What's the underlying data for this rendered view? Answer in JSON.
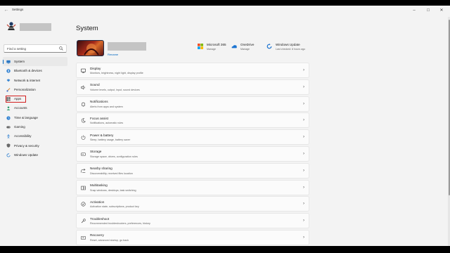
{
  "window": {
    "title": "Settings",
    "back_glyph": "←",
    "min_glyph": "–",
    "max_glyph": "☐",
    "close_glyph": "✕"
  },
  "search": {
    "placeholder": "Find a setting"
  },
  "sidebar": {
    "items": [
      {
        "label": "System",
        "icon": "system-icon",
        "active": true
      },
      {
        "label": "Bluetooth & devices",
        "icon": "bluetooth-icon"
      },
      {
        "label": "Network & internet",
        "icon": "network-icon"
      },
      {
        "label": "Personalization",
        "icon": "personalization-icon"
      },
      {
        "label": "Apps",
        "icon": "apps-icon",
        "highlighted": true
      },
      {
        "label": "Accounts",
        "icon": "accounts-icon"
      },
      {
        "label": "Time & language",
        "icon": "time-language-icon"
      },
      {
        "label": "Gaming",
        "icon": "gaming-icon"
      },
      {
        "label": "Accessibility",
        "icon": "accessibility-icon"
      },
      {
        "label": "Privacy & security",
        "icon": "privacy-icon"
      },
      {
        "label": "Windows Update",
        "icon": "windows-update-icon"
      }
    ]
  },
  "main": {
    "title": "System",
    "rename_label": "Rename",
    "quick_links": [
      {
        "title": "Microsoft 365",
        "subtitle": "Manage",
        "icon": "microsoft-365-icon"
      },
      {
        "title": "OneDrive",
        "subtitle": "Manage",
        "icon": "onedrive-icon"
      },
      {
        "title": "Windows Update",
        "subtitle": "Last checked: 8 hours ago",
        "icon": "windows-update-icon"
      }
    ],
    "cards": [
      {
        "title": "Display",
        "subtitle": "Monitors, brightness, night light, display profile",
        "icon": "display-icon"
      },
      {
        "title": "Sound",
        "subtitle": "Volume levels, output, input, sound devices",
        "icon": "sound-icon"
      },
      {
        "title": "Notifications",
        "subtitle": "Alerts from apps and system",
        "icon": "notifications-icon"
      },
      {
        "title": "Focus assist",
        "subtitle": "Notifications, automatic rules",
        "icon": "focus-assist-icon"
      },
      {
        "title": "Power & battery",
        "subtitle": "Sleep, battery usage, battery saver",
        "icon": "power-icon"
      },
      {
        "title": "Storage",
        "subtitle": "Storage space, drives, configuration rules",
        "icon": "storage-icon"
      },
      {
        "title": "Nearby sharing",
        "subtitle": "Discoverability, received files location",
        "icon": "nearby-sharing-icon"
      },
      {
        "title": "Multitasking",
        "subtitle": "Snap windows, desktops, task switching",
        "icon": "multitasking-icon"
      },
      {
        "title": "Activation",
        "subtitle": "Activation state, subscriptions, product key",
        "icon": "activation-icon"
      },
      {
        "title": "Troubleshoot",
        "subtitle": "Recommended troubleshooters, preferences, history",
        "icon": "troubleshoot-icon"
      },
      {
        "title": "Recovery",
        "subtitle": "Reset, advanced startup, go back",
        "icon": "recovery-icon"
      }
    ]
  },
  "colors": {
    "accent": "#0067c0",
    "highlight_box": "#d21f1f",
    "background": "#f3f3f3",
    "card": "#fbfbfb"
  }
}
